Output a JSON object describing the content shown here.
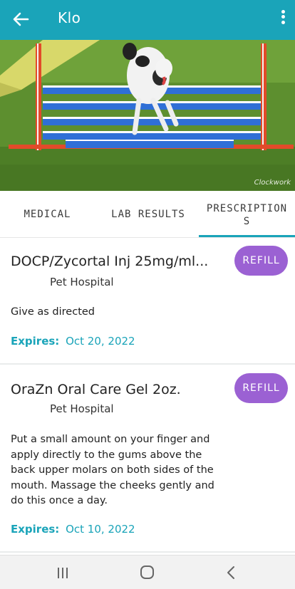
{
  "app_bar": {
    "title": "Klo",
    "back_icon": "arrow-left-icon",
    "menu_icon": "more-vertical-icon",
    "color": "#1aa4b9"
  },
  "hero": {
    "description_icon": "dog-agility-photo",
    "watermark": "Clockwork"
  },
  "tabs": [
    {
      "label": "MEDICAL",
      "active": false
    },
    {
      "label": "LAB RESULTS",
      "active": false
    },
    {
      "label": "PRESCRIPTIONS",
      "line1": "PRESCRIPTION",
      "line2": "S",
      "active": true
    }
  ],
  "prescriptions": [
    {
      "name": "DOCP/Zycortal Inj 25mg/ml...",
      "hospital": "Pet Hospital",
      "instructions": "Give as directed",
      "expires_label": "Expires:",
      "expires_date": "Oct 20, 2022",
      "refill_label": "REFILL"
    },
    {
      "name": "OraZn Oral Care Gel 2oz.",
      "hospital": "Pet Hospital",
      "instructions": "Put a small amount on your finger and apply directly to the gums above the back upper molars on both sides of the mouth. Massage the cheeks gently and do this once a day.",
      "expires_label": "Expires:",
      "expires_date": "Oct 10, 2022",
      "refill_label": "REFILL"
    }
  ],
  "colors": {
    "accent": "#1aa4b9",
    "refill": "#9b61d3"
  },
  "system_nav": {
    "recents_icon": "recents-icon",
    "home_icon": "home-icon",
    "back_icon": "system-back-icon"
  }
}
